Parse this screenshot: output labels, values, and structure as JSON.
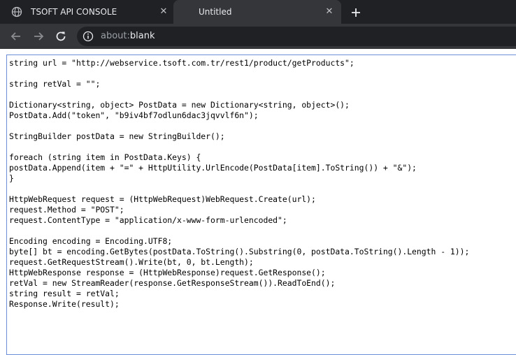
{
  "browser": {
    "tabs": [
      {
        "title": "TSOFT API CONSOLE",
        "active": false
      },
      {
        "title": "Untitled",
        "active": true
      }
    ],
    "new_tab_icon": "plus-icon",
    "address": {
      "scheme": "about:",
      "host": "blank"
    }
  },
  "colors": {
    "tabstrip": "#202124",
    "active_tab": "#35363a",
    "editor_border": "#6a8fd8",
    "spell_underline": "#e53935"
  },
  "editor": {
    "lines": [
      "string url = \"http://webservice.tsoft.com.tr/rest1/product/getProducts\";",
      "",
      "string retVal = \"\";",
      "",
      "Dictionary<string, object> PostData = new Dictionary<string, object>();",
      "PostData.Add(\"token\", \"b9iv4bf7odlun6dac3jqvvlf6n\");",
      "",
      "StringBuilder postData = new StringBuilder();",
      "",
      "foreach (string item in PostData.Keys) {",
      "postData.Append(item + \"=\" + HttpUtility.UrlEncode(PostData[item].ToString()) + \"&\");",
      "}",
      "",
      "HttpWebRequest request = (HttpWebRequest)WebRequest.Create(url);",
      "request.Method = \"POST\";",
      "request.ContentType = \"application/x-www-form-urlencoded\";",
      "",
      "Encoding encoding = Encoding.UTF8;",
      "byte[] bt = encoding.GetBytes(postData.ToString().Substring(0, postData.ToString().Length - 1));",
      "request.GetRequestStream().Write(bt, 0, bt.Length);",
      "HttpWebResponse response = (HttpWebResponse)request.GetResponse();",
      "retVal = new StreamReader(response.GetResponseStream()).ReadToEnd();",
      "string result = retVal;",
      "Response.Write(result);"
    ]
  }
}
